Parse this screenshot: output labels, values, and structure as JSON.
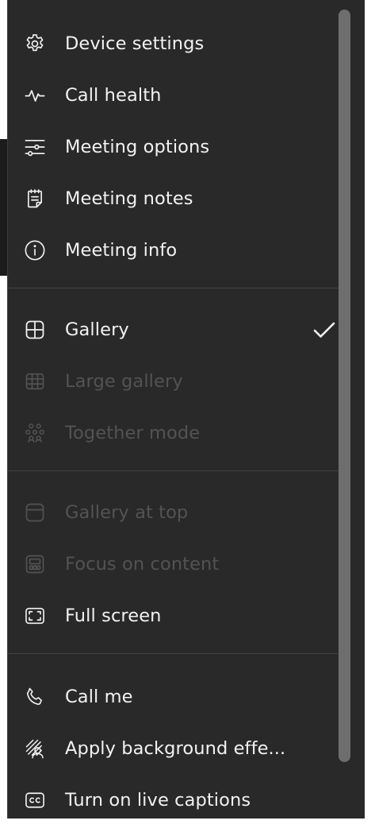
{
  "menu": {
    "items": [
      {
        "label": "Device settings",
        "icon": "gear-icon",
        "disabled": false
      },
      {
        "label": "Call health",
        "icon": "pulse-icon",
        "disabled": false
      },
      {
        "label": "Meeting options",
        "icon": "sliders-icon",
        "disabled": false
      },
      {
        "label": "Meeting notes",
        "icon": "notes-icon",
        "disabled": false
      },
      {
        "label": "Meeting info",
        "icon": "info-icon",
        "disabled": false
      },
      {
        "label": "Gallery",
        "icon": "grid-icon",
        "disabled": false,
        "checked": true
      },
      {
        "label": "Large gallery",
        "icon": "large-grid-icon",
        "disabled": true
      },
      {
        "label": "Together mode",
        "icon": "people-group-icon",
        "disabled": true
      },
      {
        "label": "Gallery at top",
        "icon": "gallery-top-icon",
        "disabled": true
      },
      {
        "label": "Focus on content",
        "icon": "focus-content-icon",
        "disabled": true
      },
      {
        "label": "Full screen",
        "icon": "fullscreen-icon",
        "disabled": false
      },
      {
        "label": "Call me",
        "icon": "phone-icon",
        "disabled": false
      },
      {
        "label": "Apply background effe...",
        "icon": "background-effects-icon",
        "disabled": false
      },
      {
        "label": "Turn on live captions",
        "icon": "captions-icon",
        "disabled": false
      }
    ]
  },
  "colors": {
    "menu_background": "#292929",
    "text": "#f2f2f2",
    "disabled_text": "#535353",
    "divider": "#434343",
    "scrollbar": "#6e6e6e"
  }
}
